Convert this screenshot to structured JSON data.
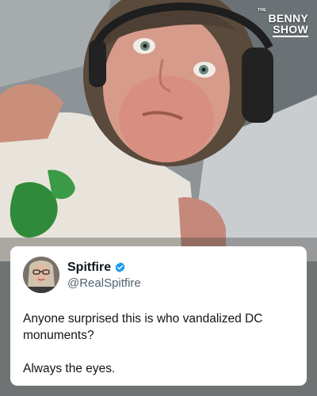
{
  "logo": {
    "the": "THE",
    "line1": "BENNY",
    "line2": "SHOW"
  },
  "tweet": {
    "display_name": "Spitfire",
    "handle": "@RealSpitfire",
    "verified": true,
    "paragraphs": [
      "Anyone surprised this is who vandalized DC monuments?",
      "Always the eyes."
    ]
  },
  "icons": {
    "verified": "verified-badge-icon",
    "avatar": "profile-avatar"
  },
  "colors": {
    "verified_blue": "#1d9bf0",
    "card_bg": "#ffffff",
    "handle_gray": "#536471",
    "text_dark": "#0f1419"
  }
}
